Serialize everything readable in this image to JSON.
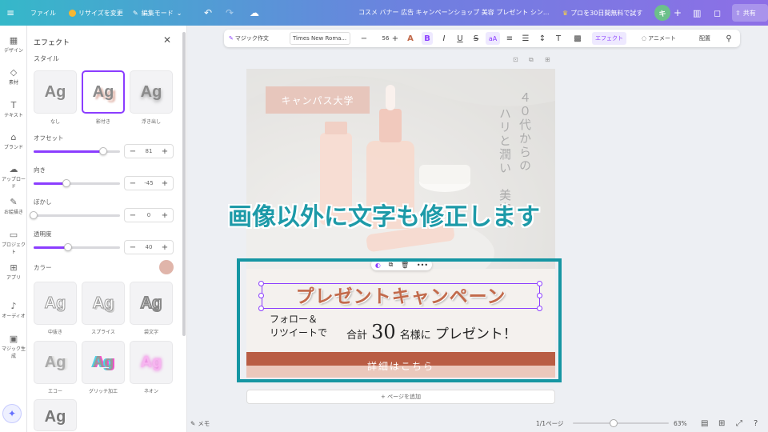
{
  "topbar": {
    "menu_icon": "≡",
    "file": "ファイル",
    "resize": "リサイズを変更",
    "edit_mode": "編集モード",
    "title": "コスメ バナー 広告 キャンペーンショップ 美容 プレゼント シン...",
    "pro_trial": "プロを30日間無料で試す",
    "avatar_initial": "キ",
    "share": "共有"
  },
  "rail": {
    "items": [
      {
        "icon": "▦",
        "label": "デザイン"
      },
      {
        "icon": "◇",
        "label": "素材"
      },
      {
        "icon": "T",
        "label": "テキスト"
      },
      {
        "icon": "⌂",
        "label": "ブランド"
      },
      {
        "icon": "☁",
        "label": "アップロード"
      },
      {
        "icon": "✎",
        "label": "お絵描き"
      },
      {
        "icon": "▭",
        "label": "プロジェクト"
      },
      {
        "icon": "⊞",
        "label": "アプリ"
      },
      {
        "icon": "♪",
        "label": "オーディオ"
      },
      {
        "icon": "▣",
        "label": "マジック生成"
      }
    ]
  },
  "panel": {
    "title": "エフェクト",
    "style_label": "スタイル",
    "styles_row1": [
      {
        "sample": "Ag",
        "caption": "なし"
      },
      {
        "sample": "Ag",
        "caption": "影付き"
      },
      {
        "sample": "Ag",
        "caption": "浮き出し"
      }
    ],
    "controls": [
      {
        "label": "オフセット",
        "value": "81",
        "level": 0.81
      },
      {
        "label": "向き",
        "value": "-45",
        "level": 0.38
      },
      {
        "label": "ぼかし",
        "value": "0",
        "level": 0.0
      },
      {
        "label": "透明度",
        "value": "40",
        "level": 0.4
      }
    ],
    "color_label": "カラー",
    "shadow_color": "#e0b5aa",
    "styles_row2": [
      {
        "sample": "Ag",
        "caption": "中抜き"
      },
      {
        "sample": "Ag",
        "caption": "スプライス"
      },
      {
        "sample": "Ag",
        "caption": "袋文字"
      }
    ],
    "styles_row3": [
      {
        "sample": "Ag",
        "caption": "エコー"
      },
      {
        "sample": "Ag",
        "caption": "グリッチ加工"
      },
      {
        "sample": "Ag",
        "caption": "ネオン"
      }
    ],
    "styles_row4": [
      {
        "sample": "Ag",
        "caption": ""
      }
    ]
  },
  "format_toolbar": {
    "magic_write": "マジック作文",
    "font": "Times New Roma...",
    "size": "56",
    "effects": "エフェクト",
    "animate": "アニメート",
    "position": "配置"
  },
  "design": {
    "ribbon": "キャンパス大学",
    "vertical_lines": [
      "４０代からの",
      "ハリと潤い",
      "美容液"
    ],
    "title": "プレゼントキャンペーン",
    "follow_line1": "フォロー＆",
    "follow_line2": "リツイートで",
    "total": "合計",
    "count": "30",
    "people_suffix": "名様に",
    "present": "プレゼント！",
    "cta": "詳細はこちら"
  },
  "overlay_caption": "画像以外に文字も修正します",
  "add_page": "+ ページを追加",
  "bottom": {
    "notes": "メモ",
    "page_count": "1/1ページ",
    "zoom": "63%"
  },
  "colors": {
    "accent": "#8b3dff",
    "highlight": "#1596a3",
    "title_text": "#c26a4b",
    "cta_bar": "#b95d44"
  }
}
